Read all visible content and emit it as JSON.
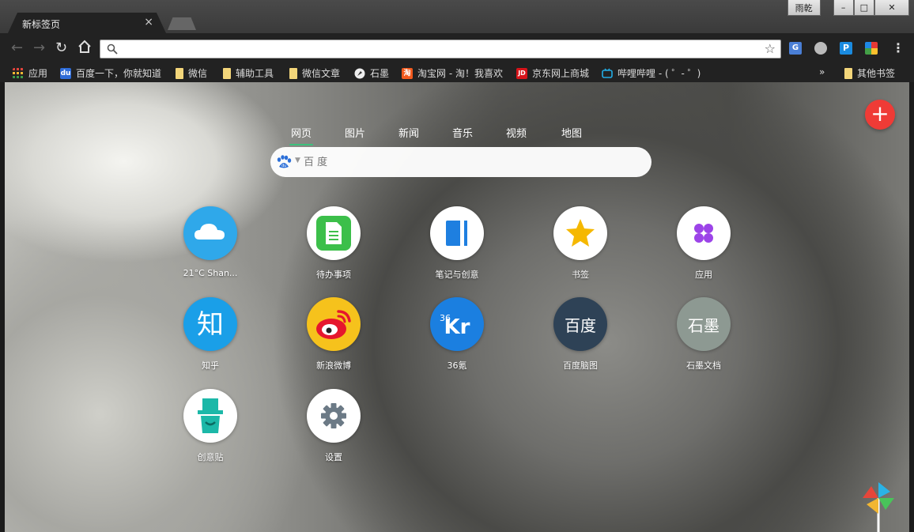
{
  "window": {
    "tab_title": "新标签页",
    "tab_close": "×",
    "user_label": "雨乾",
    "minimize": "–",
    "maximize": "□",
    "close": "✕"
  },
  "toolbar": {
    "address_value": "",
    "back": "←",
    "forward": "→",
    "reload": "↻",
    "star": "☆",
    "menu": "⋮",
    "extensions": [
      "translate-icon",
      "circle-extension-icon",
      "p-extension-icon",
      "color-extension-icon"
    ]
  },
  "bookmarks": {
    "items": [
      {
        "label": "应用",
        "icon": "apps-grid-icon"
      },
      {
        "label": "百度一下，你就知道",
        "icon": "baidu-icon"
      },
      {
        "label": "微信",
        "icon": "folder-icon"
      },
      {
        "label": "辅助工具",
        "icon": "folder-icon"
      },
      {
        "label": "微信文章",
        "icon": "folder-icon"
      },
      {
        "label": "石墨",
        "icon": "shimo-icon"
      },
      {
        "label": "淘宝网 - 淘！我喜欢",
        "icon": "taobao-icon"
      },
      {
        "label": "京东网上商城",
        "icon": "jd-icon"
      },
      {
        "label": "哔哩哔哩 - ( ゜- ゜)",
        "icon": "bilibili-icon"
      }
    ],
    "overflow": "»",
    "other": "其他书签"
  },
  "search": {
    "tabs": [
      "网页",
      "图片",
      "新闻",
      "音乐",
      "视频",
      "地图"
    ],
    "active_tab": "网页",
    "placeholder": "百 度"
  },
  "tiles": [
    {
      "label": "21°C Shan...",
      "icon": "cloud-weather-icon"
    },
    {
      "label": "待办事项",
      "icon": "todo-document-icon"
    },
    {
      "label": "笔记与创意",
      "icon": "notebook-icon"
    },
    {
      "label": "书签",
      "icon": "star-icon"
    },
    {
      "label": "应用",
      "icon": "apps-clover-icon"
    },
    {
      "label": "知乎",
      "icon": "zhihu-icon",
      "text": "知"
    },
    {
      "label": "新浪微博",
      "icon": "weibo-icon"
    },
    {
      "label": "36氪",
      "icon": "36kr-icon",
      "text": "Kr",
      "sup": "36"
    },
    {
      "label": "百度脑图",
      "icon": "baidu-naotu-icon",
      "text": "百度"
    },
    {
      "label": "石墨文档",
      "icon": "shimo-docs-icon",
      "text": "石墨"
    },
    {
      "label": "创意贴",
      "icon": "creative-sticker-icon"
    },
    {
      "label": "设置",
      "icon": "settings-gear-icon"
    }
  ],
  "fab": "+",
  "colors": {
    "fab": "#ef3b36",
    "active_tab_underline": "#3cc07c",
    "weather": "#2fa8ea",
    "todo": "#3cbf4a",
    "notes": "#1e7fe0",
    "star": "#f5b800",
    "apps": "#9c44e8",
    "zhihu": "#1a9fe8",
    "36kr": "#1b7fe0",
    "naotu": "#2e4256",
    "shimo": "#8d9992",
    "creative": "#1cb8a8",
    "settings": "#6c7a86"
  }
}
